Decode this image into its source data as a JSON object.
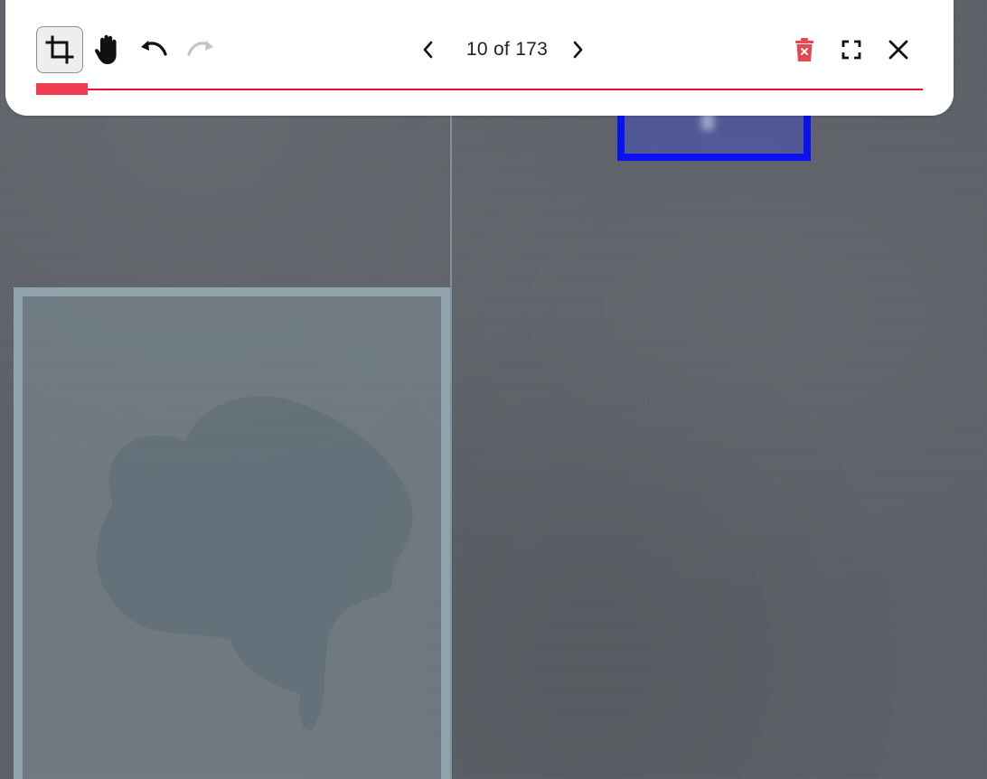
{
  "viewer": {
    "toolbar": {
      "tools": [
        {
          "name": "crop-tool",
          "icon": "crop-icon",
          "active": true
        },
        {
          "name": "pan-tool",
          "icon": "hand-icon",
          "active": false
        },
        {
          "name": "undo",
          "icon": "undo-icon",
          "enabled": true
        },
        {
          "name": "redo",
          "icon": "redo-icon",
          "enabled": false
        }
      ],
      "pager": {
        "current": 10,
        "total": 173,
        "label": "10 of 173",
        "prev_icon": "chevron-left-icon",
        "next_icon": "chevron-right-icon"
      },
      "actions": [
        {
          "name": "delete",
          "icon": "trash-icon",
          "color": "#e5484d"
        },
        {
          "name": "fullscreen",
          "icon": "fullscreen-icon"
        },
        {
          "name": "close",
          "icon": "close-icon"
        }
      ],
      "progress": {
        "fraction": 0.0578,
        "fill_color": "#ee3b4d",
        "track_color": "#e8112d"
      }
    },
    "annotations": [
      {
        "type": "crop-region",
        "color": "#96aab4"
      },
      {
        "type": "bounding-box",
        "color": "#0a12f0"
      }
    ]
  }
}
